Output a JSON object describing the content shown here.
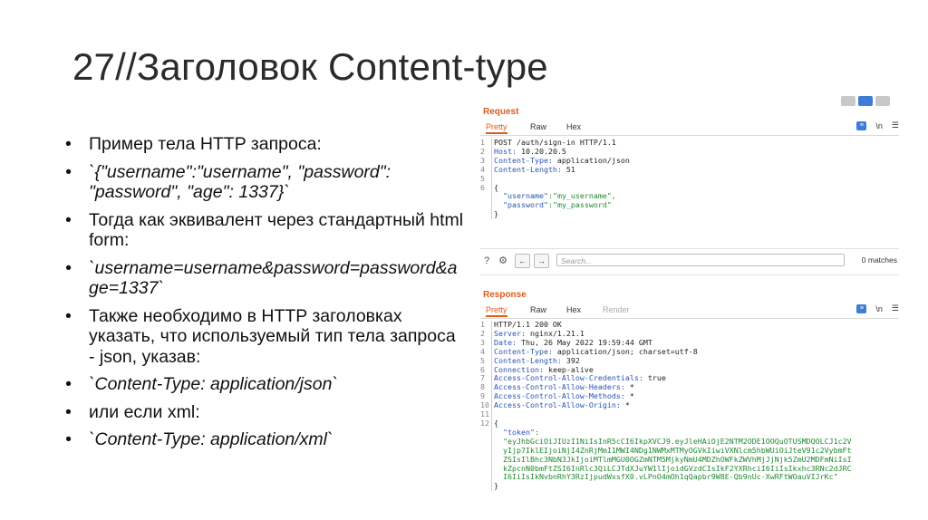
{
  "slide": {
    "title": "27//Заголовок Content-type",
    "bullets": [
      "Пример тела HTTP запроса:",
      "`{\"username\":\"username\", \"password\": \"password\", \"age\": 1337}`",
      "Тогда как эквивалент через стандартный html form:",
      "`username=username&password=password&age=1337`",
      "Также необходимо в HTTP заголовках указать, что используемый тип тела запроса - json, указав:",
      "`Content-Type: application/json`",
      "или если xml:",
      "`Content-Type: application/xml`"
    ]
  },
  "request": {
    "label": "Request",
    "tabs": [
      "Pretty",
      "Raw",
      "Hex"
    ],
    "icons": [
      "format-icon",
      "newline-icon",
      "menu-icon"
    ],
    "lines": [
      {
        "n": "1",
        "t": "POST /auth/sign-in HTTP/1.1"
      },
      {
        "n": "2",
        "k": "Host:",
        "v": " 10.20.20.5"
      },
      {
        "n": "3",
        "k": "Content-Type:",
        "v": " application/json"
      },
      {
        "n": "4",
        "k": "Content-Length:",
        "v": " 51"
      },
      {
        "n": "5",
        "t": ""
      },
      {
        "n": "6",
        "t": "{"
      },
      {
        "n": "",
        "jk": "  \"username\"",
        "jv": ":\"my_username\","
      },
      {
        "n": "",
        "jk": "  \"password\"",
        "jv": ":\"my_password\""
      },
      {
        "n": "",
        "t": "}"
      }
    ]
  },
  "search": {
    "placeholder": "Search...",
    "matches": "0 matches",
    "icons": [
      "help-icon",
      "settings-icon",
      "back-arrow-icon",
      "forward-arrow-icon"
    ]
  },
  "response": {
    "label": "Response",
    "tabs": [
      "Pretty",
      "Raw",
      "Hex",
      "Render"
    ],
    "lines": [
      {
        "n": "1",
        "t": "HTTP/1.1 200 OK"
      },
      {
        "n": "2",
        "k": "Server:",
        "v": " nginx/1.21.1"
      },
      {
        "n": "3",
        "k": "Date:",
        "v": " Thu, 26 May 2022 19:59:44 GMT"
      },
      {
        "n": "4",
        "k": "Content-Type:",
        "v": " application/json; charset=utf-8"
      },
      {
        "n": "5",
        "k": "Content-Length:",
        "v": " 392"
      },
      {
        "n": "6",
        "k": "Connection:",
        "v": " keep-alive"
      },
      {
        "n": "7",
        "k": "Access-Control-Allow-Credentials:",
        "v": " true"
      },
      {
        "n": "8",
        "k": "Access-Control-Allow-Headers:",
        "v": " *"
      },
      {
        "n": "9",
        "k": "Access-Control-Allow-Methods:",
        "v": " *"
      },
      {
        "n": "10",
        "k": "Access-Control-Allow-Origin:",
        "v": " *"
      },
      {
        "n": "11",
        "t": ""
      },
      {
        "n": "12",
        "t": "{"
      },
      {
        "n": "",
        "jk": "  \"token\"",
        "jv": ":"
      },
      {
        "n": "",
        "tok": "  \"eyJhbGciOiJIUzI1NiIsInR5cCI6IkpXVCJ9.eyJleHAiOjE2NTM2ODE1OOQuOTUSMDQOLCJ1c2V"
      },
      {
        "n": "",
        "tok": "  yIjp7IklEIjoiNjI4ZnRjMmI1MWI4NDg1NWMxMTMyOGVkIiwiVXNlcm5hbWUiOiJteV91c2VybmFt"
      },
      {
        "n": "",
        "tok": "  ZSIsIlBhc3NbN3JkIjoiMTlmMGU0OGZmNTM5MjkyNmU4MDZhOWFkZWVhMjJjNjk5ZmU2MDFmNiIsI"
      },
      {
        "n": "",
        "tok": "  kZpcnN0bmFtZSI6InRlc3QiLCJTdXJuYW1lIjoidGVzdCIsIkF2YXRhciI6IiIsIkxhc3RNc2dJRC"
      },
      {
        "n": "",
        "tok": "  I6IiIsIkNvbnRhY3RzIjpudWxsfX0.vLPnO4mOh1qQapbr9W8E-Qb9nUc-XwRFtWOauVIJrKc\""
      },
      {
        "n": "",
        "t": "}"
      }
    ]
  }
}
